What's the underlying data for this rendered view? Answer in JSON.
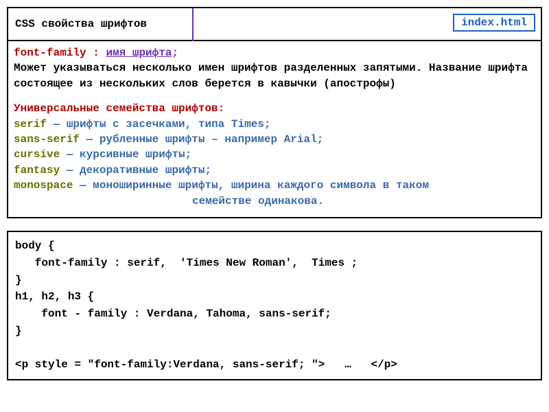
{
  "header": {
    "title": "CSS свойства шрифтов",
    "filename": "index.html"
  },
  "syntax": {
    "property": "font-family",
    "colon": " : ",
    "value": "имя шрифта",
    "semicolon": ";"
  },
  "description": "Может указываться  несколько имен шрифтов разделенных запятыми. Название шрифта состоящее из нескольких слов берется в кавычки (апострофы)",
  "families_title": "Универсальные семейства шрифтов:",
  "families": [
    {
      "name": "serif",
      "dash": " — ",
      "desc": "шрифты с засечками, типа Times;"
    },
    {
      "name": "sans-serif",
      "dash": " — ",
      "desc": "рубленные шрифты – например Arial;"
    },
    {
      "name": "cursive",
      "dash": " — ",
      "desc": "курсивные шрифты;"
    },
    {
      "name": "fantasy",
      "dash": " — ",
      "desc": "декоративные шрифты;"
    },
    {
      "name": "monospace",
      "dash": " — ",
      "desc": "моноширинные шрифты, ширина каждого символа в таком"
    }
  ],
  "families_last_cont": "семействе одинакова.",
  "code": {
    "l1": "body {",
    "l2": "   font-family : serif,  'Times New Roman',  Times ;",
    "l3": "}",
    "l4": "h1, h2, h3 {",
    "l5": "    font - family : Verdana, Tahoma, sans-serif;",
    "l6": "}",
    "l7": "",
    "l8": "<p style = \"font-family:Verdana, sans-serif; \">   …   </p>"
  }
}
